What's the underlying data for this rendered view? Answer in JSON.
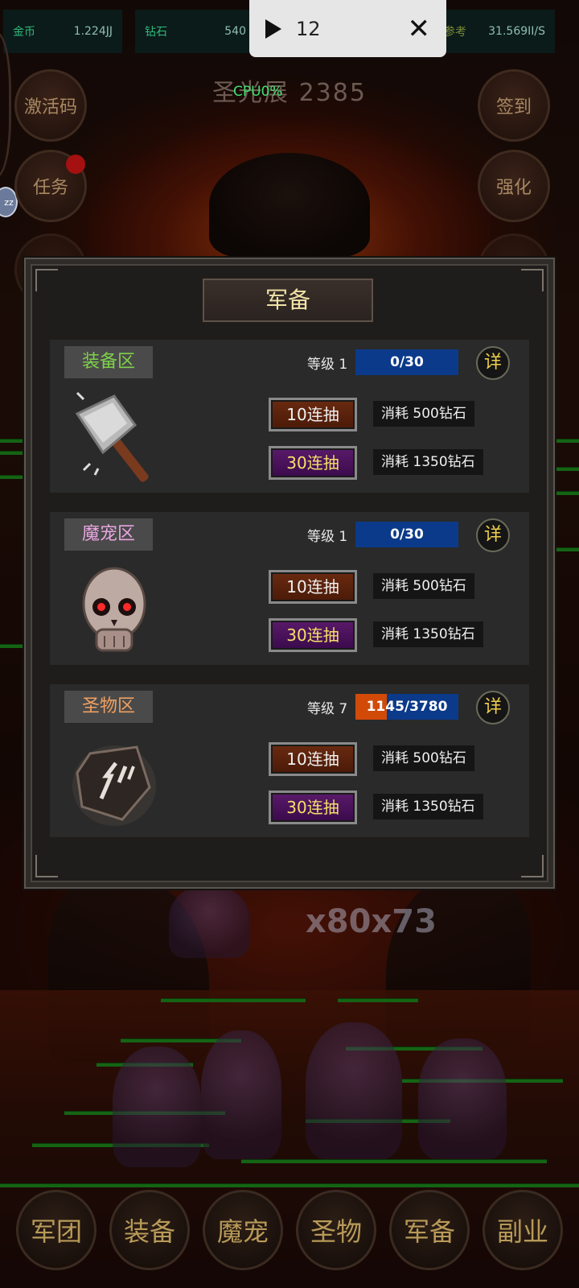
{
  "hud": {
    "gold_label": "金币",
    "gold_value": "1.224JJ",
    "diamond_label": "钻石",
    "diamond_value": "540",
    "ref_label": "参考",
    "ref_value": "31.569II/S"
  },
  "playback": {
    "count": "12"
  },
  "background": {
    "title": "圣光展 2385",
    "cpu": "CPU0%",
    "multiplier": "x80x73"
  },
  "side_buttons": {
    "activation_code": "激活码",
    "task": "任务",
    "checkin": "签到",
    "enhance": "强化",
    "badge": "zz"
  },
  "modal": {
    "title": "军备",
    "level_prefix": "等级",
    "detail": "详",
    "sections": [
      {
        "name": "装备区",
        "tag_color": "#7ed04a",
        "level": "1",
        "progress_text": "0/30",
        "progress": 0,
        "draw10": "10连抽",
        "draw30": "30连抽",
        "cost10": "消耗 500钻石",
        "cost30": "消耗 1350钻石",
        "icon": "axe-icon"
      },
      {
        "name": "魔宠区",
        "tag_color": "#e8a6e0",
        "level": "1",
        "progress_text": "0/30",
        "progress": 0,
        "draw10": "10连抽",
        "draw30": "30连抽",
        "cost10": "消耗 500钻石",
        "cost30": "消耗 1350钻石",
        "icon": "skull-icon"
      },
      {
        "name": "圣物区",
        "tag_color": "#f0a060",
        "level": "7",
        "progress_text": "1145/3780",
        "progress": 0.303,
        "draw10": "10连抽",
        "draw30": "30连抽",
        "cost10": "消耗 500钻石",
        "cost30": "消耗 1350钻石",
        "icon": "rune-stone-icon"
      }
    ]
  },
  "bottom_nav": [
    "军团",
    "装备",
    "魔宠",
    "圣物",
    "军备",
    "副业"
  ],
  "colors": {
    "nav_text": "#b89a58",
    "accent_gold": "#f1e4a8"
  }
}
